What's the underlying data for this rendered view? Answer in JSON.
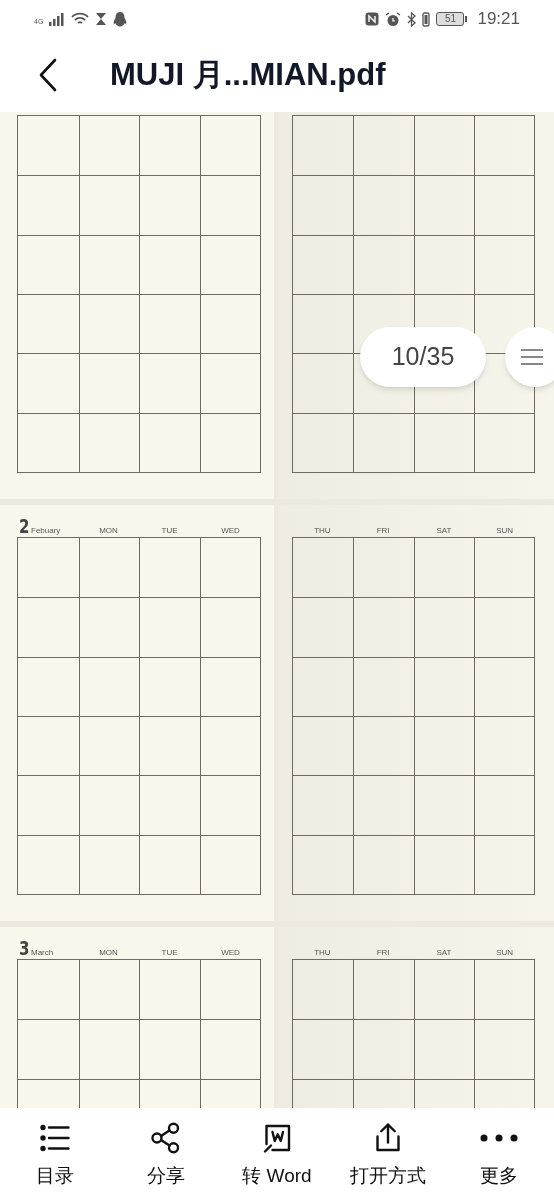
{
  "status_bar": {
    "network": "4G",
    "battery": "51",
    "time": "19:21"
  },
  "header": {
    "title": "MUJI 月...MIAN.pdf"
  },
  "months": [
    {
      "kind": "cut"
    },
    {
      "number": "2",
      "name": "Febuary",
      "left_days": [
        "MON",
        "TUE",
        "WED"
      ],
      "right_days": [
        "THU",
        "FRI",
        "SAT",
        "SUN"
      ]
    },
    {
      "number": "3",
      "name": "March",
      "left_days": [
        "MON",
        "TUE",
        "WED"
      ],
      "right_days": [
        "THU",
        "FRI",
        "SAT",
        "SUN"
      ]
    }
  ],
  "page_indicator": "10/35",
  "toolbar": [
    {
      "kind": "contents",
      "label": "目录"
    },
    {
      "kind": "share",
      "label": "分享"
    },
    {
      "kind": "word",
      "label": "转 Word"
    },
    {
      "kind": "open",
      "label": "打开方式"
    },
    {
      "kind": "more",
      "label": "更多"
    }
  ]
}
